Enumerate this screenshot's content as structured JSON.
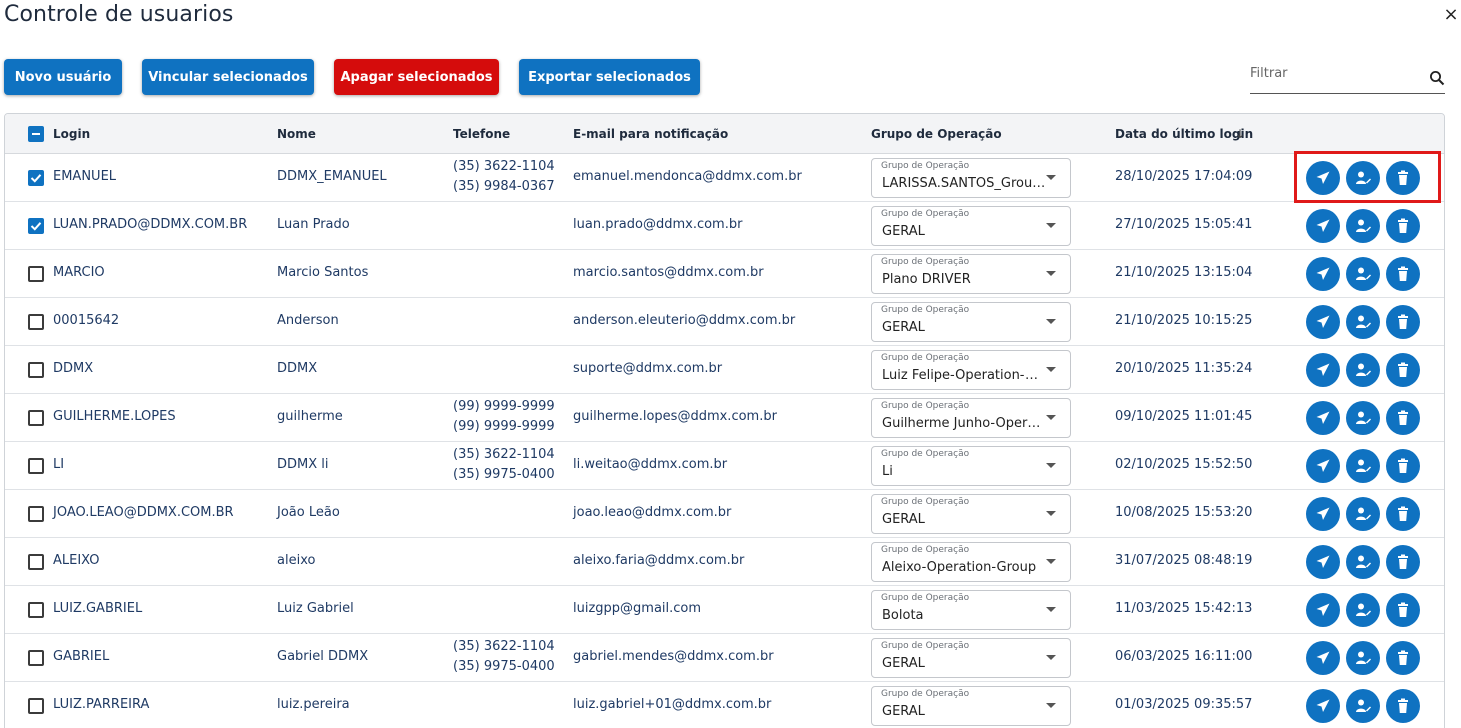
{
  "page": {
    "title": "Controle de usuarios",
    "close_glyph": "×"
  },
  "toolbar": {
    "new_user": "Novo usuário",
    "link_selected": "Vincular selecionados",
    "delete_selected": "Apagar selecionados",
    "export_selected": "Exportar selecionados"
  },
  "filter": {
    "placeholder": "Filtrar",
    "icon": "search-icon"
  },
  "table": {
    "headers": {
      "login": "Login",
      "name": "Nome",
      "phone": "Telefone",
      "email": "E-mail para notificação",
      "group": "Grupo de Operação",
      "last_login": "Data do último login",
      "sort_glyph": "↓"
    },
    "group_field_label": "Grupo de Operação",
    "rows": [
      {
        "checked": true,
        "login": "EMANUEL",
        "name": "DDMX_EMANUEL",
        "phone1": "(35) 3622-1104",
        "phone2": "(35) 9984-0367",
        "email": "emanuel.mendonca@ddmx.com.br",
        "group": "LARISSA.SANTOS_Group-Operation",
        "last_login": "28/10/2025 17:04:09"
      },
      {
        "checked": true,
        "login": "LUAN.PRADO@DDMX.COM.BR",
        "name": "Luan Prado",
        "phone1": "",
        "phone2": "",
        "email": "luan.prado@ddmx.com.br",
        "group": "GERAL",
        "last_login": "27/10/2025 15:05:41"
      },
      {
        "checked": false,
        "login": "MARCIO",
        "name": "Marcio Santos",
        "phone1": "",
        "phone2": "",
        "email": "marcio.santos@ddmx.com.br",
        "group": "Plano DRIVER",
        "last_login": "21/10/2025 13:15:04"
      },
      {
        "checked": false,
        "login": "00015642",
        "name": "Anderson",
        "phone1": "",
        "phone2": "",
        "email": "anderson.eleuterio@ddmx.com.br",
        "group": "GERAL",
        "last_login": "21/10/2025 10:15:25"
      },
      {
        "checked": false,
        "login": "DDMX",
        "name": "DDMX",
        "phone1": "",
        "phone2": "",
        "email": "suporte@ddmx.com.br",
        "group": "Luiz Felipe-Operation-Group",
        "last_login": "20/10/2025 11:35:24"
      },
      {
        "checked": false,
        "login": "GUILHERME.LOPES",
        "name": "guilherme",
        "phone1": "(99) 9999-9999",
        "phone2": "(99) 9999-9999",
        "email": "guilherme.lopes@ddmx.com.br",
        "group": "Guilherme Junho-Operation-Group",
        "last_login": "09/10/2025 11:01:45"
      },
      {
        "checked": false,
        "login": "LI",
        "name": "DDMX li",
        "phone1": "(35) 3622-1104",
        "phone2": "(35) 9975-0400",
        "email": "li.weitao@ddmx.com.br",
        "group": "Li",
        "last_login": "02/10/2025 15:52:50"
      },
      {
        "checked": false,
        "login": "JOAO.LEAO@DDMX.COM.BR",
        "name": "João Leão",
        "phone1": "",
        "phone2": "",
        "email": "joao.leao@ddmx.com.br",
        "group": "GERAL",
        "last_login": "10/08/2025 15:53:20"
      },
      {
        "checked": false,
        "login": "ALEIXO",
        "name": "aleixo",
        "phone1": "",
        "phone2": "",
        "email": "aleixo.faria@ddmx.com.br",
        "group": "Aleixo-Operation-Group",
        "last_login": "31/07/2025 08:48:19"
      },
      {
        "checked": false,
        "login": "LUIZ.GABRIEL",
        "name": "Luiz Gabriel",
        "phone1": "",
        "phone2": "",
        "email": "luizgpp@gmail.com",
        "group": "Bolota",
        "last_login": "11/03/2025 15:42:13"
      },
      {
        "checked": false,
        "login": "GABRIEL",
        "name": "Gabriel DDMX",
        "phone1": "(35) 3622-1104",
        "phone2": "(35) 9975-0400",
        "email": "gabriel.mendes@ddmx.com.br",
        "group": "GERAL",
        "last_login": "06/03/2025 16:11:00"
      },
      {
        "checked": false,
        "login": "LUIZ.PARREIRA",
        "name": "luiz.pereira",
        "phone1": "",
        "phone2": "",
        "email": "luiz.gabriel+01@ddmx.com.br",
        "group": "GERAL",
        "last_login": "01/03/2025 09:35:57"
      }
    ],
    "row_actions": [
      "send-icon",
      "edit-user-icon",
      "trash-icon"
    ]
  },
  "colors": {
    "primary": "#0f72c1",
    "danger": "#d50c0c",
    "highlight": "#e01919"
  }
}
